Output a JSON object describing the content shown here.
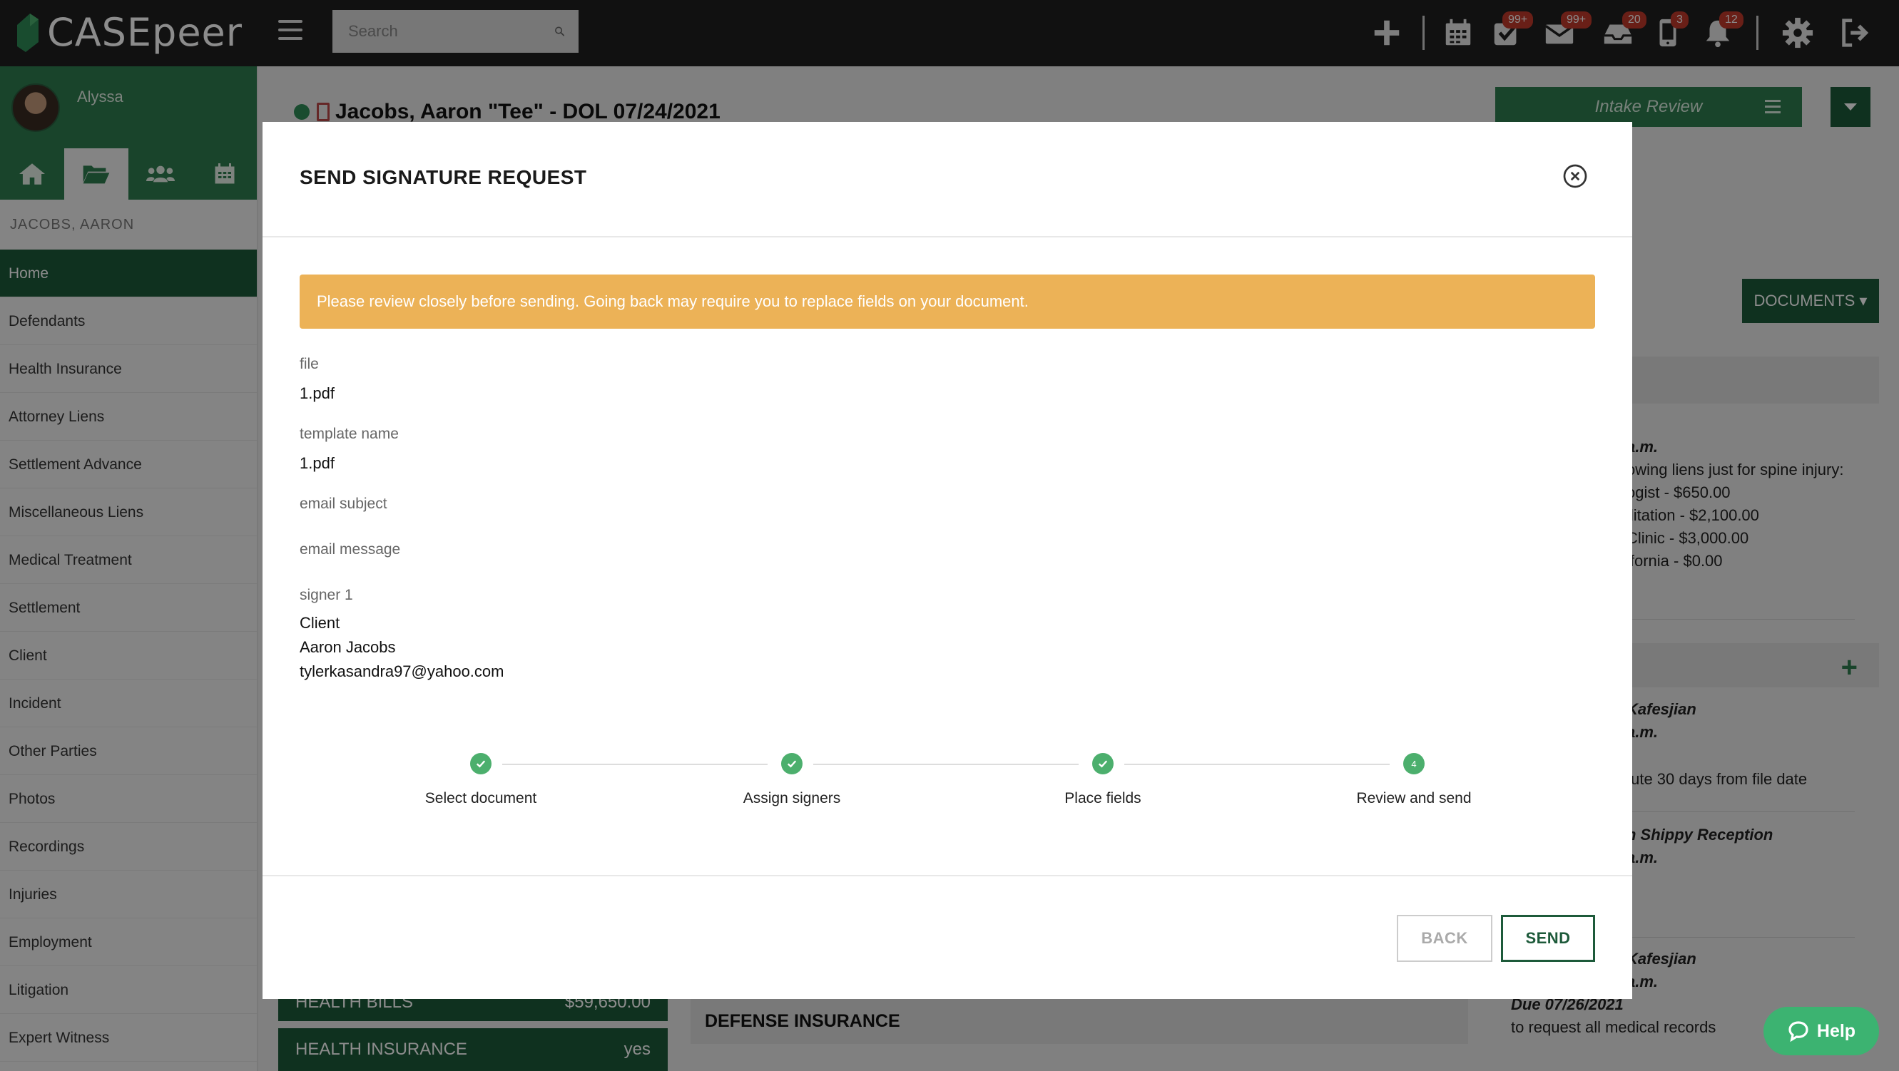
{
  "app": {
    "logo_text": "CASEpeer",
    "search_placeholder": "Search"
  },
  "topbar": {
    "badges": {
      "tasks": "99+",
      "mail": "99+",
      "inbox": "20",
      "phone": "3",
      "notifications": "12"
    }
  },
  "sidebar": {
    "username": "Alyssa",
    "case_label": "JACOBS, AARON",
    "items": [
      "Home",
      "Defendants",
      "Health Insurance",
      "Attorney Liens",
      "Settlement Advance",
      "Miscellaneous Liens",
      "Medical Treatment",
      "Settlement",
      "Client",
      "Incident",
      "Other Parties",
      "Photos",
      "Recordings",
      "Injuries",
      "Employment",
      "Litigation",
      "Expert Witness"
    ]
  },
  "page": {
    "case_title": "Jacobs, Aaron \"Tee\" - DOL 07/24/2021",
    "intake_review": "Intake Review",
    "documents_button": "DOCUMENTS ▾",
    "right_panel": {
      "fragments": [
        "a.m.",
        "owing liens just for spine injury:",
        "ogist - $650.00",
        "ilitation - $2,100.00",
        "Clinic - $3,000.00",
        "ifornia - $0.00",
        "Kafesjian",
        "a.m.",
        "tute 30 days from file date",
        "h Shippy Reception",
        "a.m.",
        "Kafesjian",
        "a.m.",
        "Due 07/26/2021",
        "to request all medical records"
      ]
    },
    "health_bills_label": "HEALTH BILLS",
    "health_bills_value": "$59,650.00",
    "health_insurance_label": "HEALTH INSURANCE",
    "health_insurance_value": "yes",
    "defense_insurance": "DEFENSE INSURANCE",
    "help_label": "Help"
  },
  "modal": {
    "title": "SEND SIGNATURE REQUEST",
    "warning": "Please review closely before sending. Going back may require you to replace fields on your document.",
    "fields": {
      "file_label": "file",
      "file_value": "1.pdf",
      "template_label": "template name",
      "template_value": "1.pdf",
      "email_subject_label": "email subject",
      "email_message_label": "email message",
      "signer_label": "signer 1",
      "signer_role": "Client",
      "signer_name": "Aaron Jacobs",
      "signer_email": "tylerkasandra97@yahoo.com"
    },
    "steps": [
      {
        "label": "Select document",
        "state": "done"
      },
      {
        "label": "Assign signers",
        "state": "done"
      },
      {
        "label": "Place fields",
        "state": "done"
      },
      {
        "label": "Review and send",
        "state": "current",
        "number": "4"
      }
    ],
    "back_label": "BACK",
    "send_label": "SEND"
  },
  "colors": {
    "brand_green": "#2e7d4f",
    "dark_green": "#1d5a3a",
    "warning": "#ecb257",
    "step_done": "#4caf6d",
    "badge_red": "#c0392b"
  }
}
